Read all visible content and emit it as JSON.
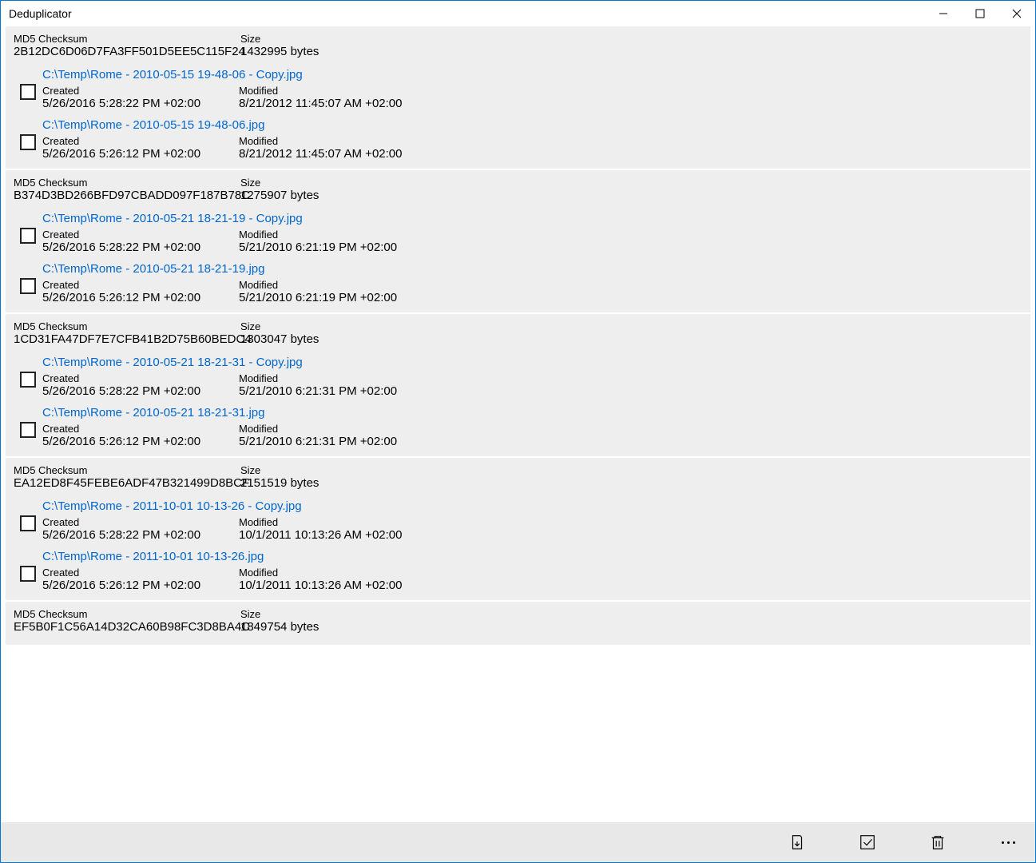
{
  "window": {
    "title": "Deduplicator"
  },
  "labels": {
    "md5": "MD5 Checksum",
    "size": "Size",
    "created": "Created",
    "modified": "Modified"
  },
  "groups": [
    {
      "checksum": "2B12DC6D06D7FA3FF501D5EE5C115F24",
      "size": "1432995 bytes",
      "files": [
        {
          "path": "C:\\Temp\\Rome - 2010-05-15 19-48-06 - Copy.jpg",
          "created": "5/26/2016 5:28:22 PM +02:00",
          "modified": "8/21/2012 11:45:07 AM +02:00"
        },
        {
          "path": "C:\\Temp\\Rome - 2010-05-15 19-48-06.jpg",
          "created": "5/26/2016 5:26:12 PM +02:00",
          "modified": "8/21/2012 11:45:07 AM +02:00"
        }
      ]
    },
    {
      "checksum": "B374D3BD266BFD97CBADD097F187B78C",
      "size": "1275907 bytes",
      "files": [
        {
          "path": "C:\\Temp\\Rome - 2010-05-21 18-21-19 - Copy.jpg",
          "created": "5/26/2016 5:28:22 PM +02:00",
          "modified": "5/21/2010 6:21:19 PM +02:00"
        },
        {
          "path": "C:\\Temp\\Rome - 2010-05-21 18-21-19.jpg",
          "created": "5/26/2016 5:26:12 PM +02:00",
          "modified": "5/21/2010 6:21:19 PM +02:00"
        }
      ]
    },
    {
      "checksum": "1CD31FA47DF7E7CFB41B2D75B60BEDC4",
      "size": "1303047 bytes",
      "files": [
        {
          "path": "C:\\Temp\\Rome - 2010-05-21 18-21-31 - Copy.jpg",
          "created": "5/26/2016 5:28:22 PM +02:00",
          "modified": "5/21/2010 6:21:31 PM +02:00"
        },
        {
          "path": "C:\\Temp\\Rome - 2010-05-21 18-21-31.jpg",
          "created": "5/26/2016 5:26:12 PM +02:00",
          "modified": "5/21/2010 6:21:31 PM +02:00"
        }
      ]
    },
    {
      "checksum": "EA12ED8F45FEBE6ADF47B321499D8BCF",
      "size": "2151519 bytes",
      "files": [
        {
          "path": "C:\\Temp\\Rome - 2011-10-01 10-13-26 - Copy.jpg",
          "created": "5/26/2016 5:28:22 PM +02:00",
          "modified": "10/1/2011 10:13:26 AM +02:00"
        },
        {
          "path": "C:\\Temp\\Rome - 2011-10-01 10-13-26.jpg",
          "created": "5/26/2016 5:26:12 PM +02:00",
          "modified": "10/1/2011 10:13:26 AM +02:00"
        }
      ]
    }
  ],
  "partial_group": {
    "checksum": "EF5B0F1C56A14D32CA60B98FC3D8BA4C",
    "size": "1849754 bytes"
  }
}
